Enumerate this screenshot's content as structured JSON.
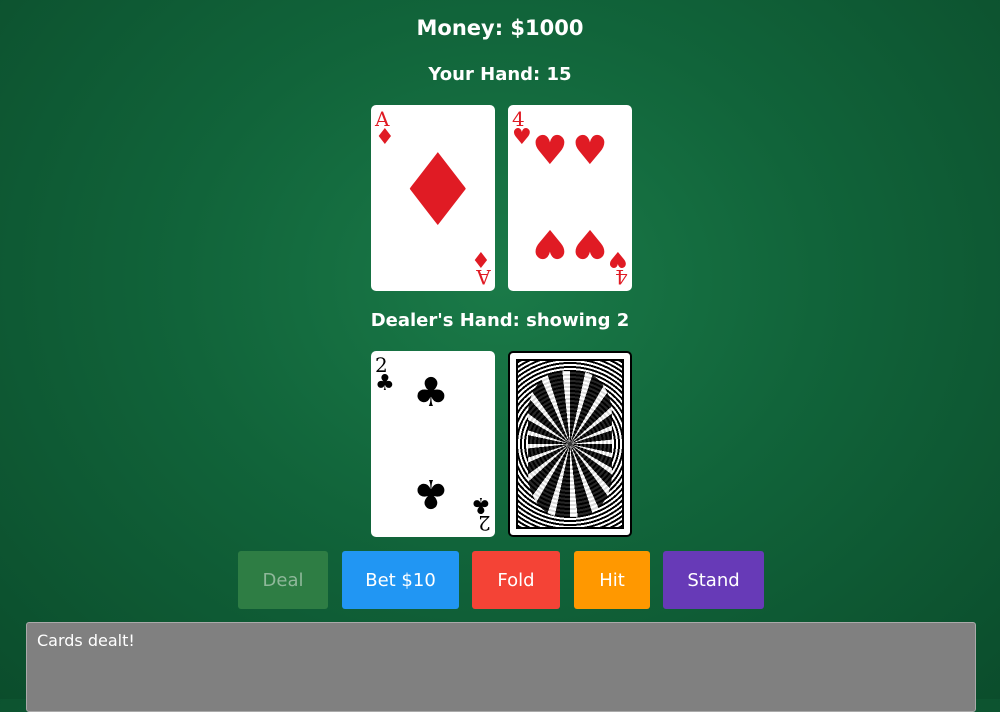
{
  "money_text": "Money: $1000",
  "player": {
    "label": "Your Hand: 15",
    "cards": [
      {
        "rank": "A",
        "suit": "♦",
        "color": "red"
      },
      {
        "rank": "4",
        "suit": "♥",
        "color": "red"
      }
    ]
  },
  "dealer": {
    "label": "Dealer's Hand: showing 2",
    "cards": [
      {
        "rank": "2",
        "suit": "♣",
        "color": "black"
      },
      {
        "rank": "",
        "suit": "",
        "face_down": true
      }
    ]
  },
  "buttons": {
    "deal": "Deal",
    "bet": "Bet $10",
    "fold": "Fold",
    "hit": "Hit",
    "stand": "Stand"
  },
  "colors": {
    "table": "#11643a",
    "deal": "#2e7d44",
    "bet": "#2196f3",
    "fold": "#f44336",
    "hit": "#ff9800",
    "stand": "#673ab7"
  },
  "message": "Cards dealt!"
}
